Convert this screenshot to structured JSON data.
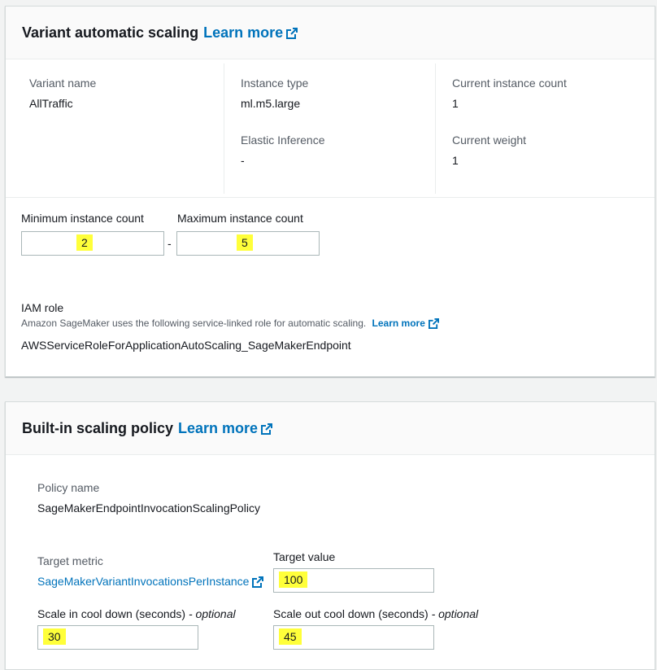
{
  "variant_scaling": {
    "title": "Variant automatic scaling",
    "learn_more": "Learn more",
    "variant_name_label": "Variant name",
    "variant_name_value": "AllTraffic",
    "instance_type_label": "Instance type",
    "instance_type_value": "ml.m5.large",
    "elastic_inference_label": "Elastic Inference",
    "elastic_inference_value": "-",
    "current_instance_count_label": "Current instance count",
    "current_instance_count_value": "1",
    "current_weight_label": "Current weight",
    "current_weight_value": "1",
    "min_label": "Minimum instance count",
    "min_value": "2",
    "separator": "-",
    "max_label": "Maximum instance count",
    "max_value": "5",
    "iam_label": "IAM role",
    "iam_description": "Amazon SageMaker uses the following service-linked role for automatic scaling.",
    "iam_learn_more": "Learn more",
    "iam_role_value": "AWSServiceRoleForApplicationAutoScaling_SageMakerEndpoint"
  },
  "scaling_policy": {
    "title": "Built-in scaling policy",
    "learn_more": "Learn more",
    "policy_name_label": "Policy name",
    "policy_name_value": "SageMakerEndpointInvocationScalingPolicy",
    "target_metric_label": "Target metric",
    "target_metric_value": "SageMakerVariantInvocationsPerInstance",
    "target_value_label": "Target value",
    "target_value": "100",
    "scale_in_label": "Scale in cool down (seconds)",
    "scale_in_optional": "- optional",
    "scale_in_value": "30",
    "scale_out_label": "Scale out cool down (seconds)",
    "scale_out_optional": "- optional",
    "scale_out_value": "45"
  },
  "colors": {
    "link": "#0073bb",
    "highlight": "#ffff3a"
  },
  "icons": {
    "external": "external-link-icon"
  }
}
